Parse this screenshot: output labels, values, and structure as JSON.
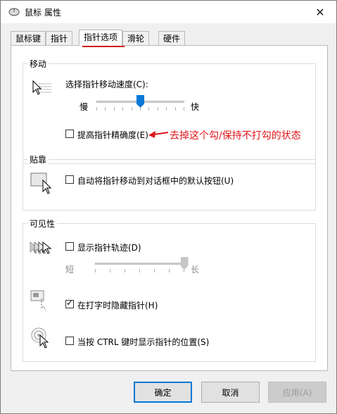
{
  "window": {
    "title": "鼠标 属性"
  },
  "tabs": [
    {
      "label": "鼠标键"
    },
    {
      "label": "指针"
    },
    {
      "label": "指针选项"
    },
    {
      "label": "滑轮"
    },
    {
      "label": "硬件"
    }
  ],
  "motion": {
    "group_label": "移动",
    "speed_label": "选择指针移动速度(C):",
    "slow_label": "慢",
    "fast_label": "快",
    "speed_level": 0.5,
    "precision_label": "提高指针精确度(E)",
    "precision_checked": false,
    "annotation": "去掉这个勾/保持不打勾的状态"
  },
  "snap": {
    "group_label": "贴靠",
    "snap_label": "自动将指针移动到对话框中的默认按钮(U)",
    "snap_checked": false
  },
  "visibility": {
    "group_label": "可见性",
    "trails_label": "显示指针轨迹(D)",
    "trails_checked": false,
    "short_label": "短",
    "long_label": "长",
    "trails_level": 1.0,
    "hide_label": "在打字时隐藏指针(H)",
    "hide_checked": true,
    "ctrl_label": "当按 CTRL 键时显示指针的位置(S)",
    "ctrl_checked": false
  },
  "buttons": {
    "ok": "确定",
    "cancel": "取消",
    "apply": "应用(A)"
  },
  "colors": {
    "accent": "#0a78d7",
    "annotation": "#e0151b"
  }
}
